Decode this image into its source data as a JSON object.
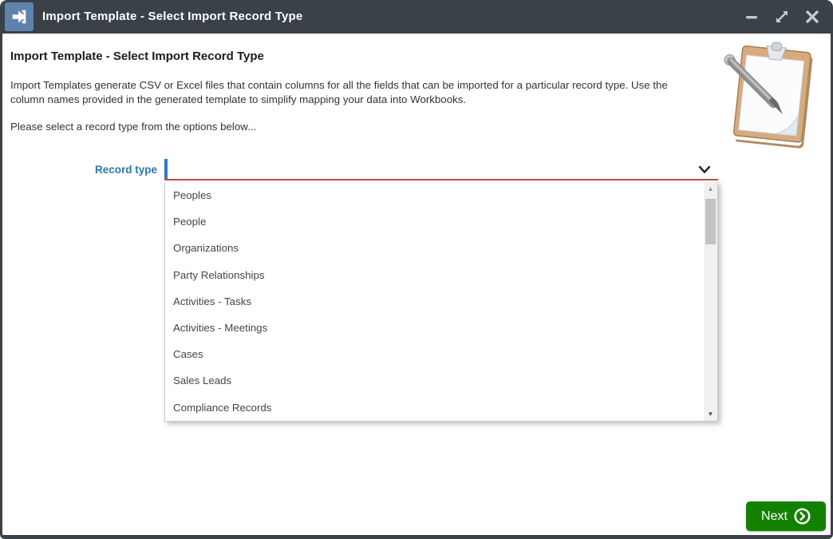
{
  "window": {
    "title": "Import Template - Select Import Record Type"
  },
  "header": {
    "title": "Import Template - Select Import Record Type"
  },
  "intro": {
    "paragraph1": "Import Templates generate CSV or Excel files that contain columns for all the fields that can be imported for a particular record type. Use the column names provided in the generated template to simplify mapping your data into Workbooks.",
    "paragraph2": "Please select a record type from the options below..."
  },
  "form": {
    "record_type_label": "Record type",
    "record_type_value": "",
    "options": [
      "Peoples",
      "People",
      "Organizations",
      "Party Relationships",
      "Activities - Tasks",
      "Activities - Meetings",
      "Cases",
      "Sales Leads",
      "Compliance Records"
    ]
  },
  "footer": {
    "next_label": "Next"
  },
  "icons": {
    "app": "import-icon",
    "controls": [
      "minimize-icon",
      "maximize-icon",
      "close-icon"
    ],
    "combo": "chevron-down-icon",
    "next": "circled-chevron-right-icon",
    "illustration": "clipboard-with-pen"
  },
  "colors": {
    "titlebar": "#3a4149",
    "app_icon_bg": "#5e84ac",
    "label_blue": "#2d77ad",
    "required_red": "#c14f3c",
    "next_green": "#138100",
    "caret_blue": "#2d7bc0"
  }
}
